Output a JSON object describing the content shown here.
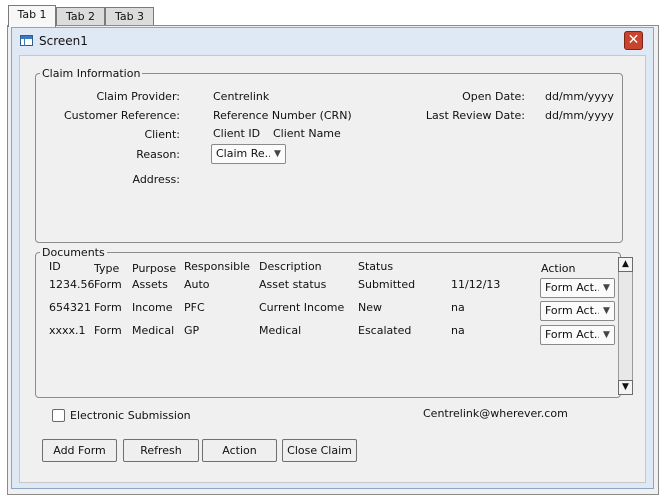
{
  "tabs": [
    {
      "label": "Tab 1"
    },
    {
      "label": "Tab 2"
    },
    {
      "label": "Tab 3"
    }
  ],
  "window": {
    "title": "Screen1",
    "close_label": "✕"
  },
  "claim_info": {
    "legend": "Claim Information",
    "provider_label": "Claim Provider:",
    "provider_value": "Centrelink",
    "reference_label": "Customer Reference:",
    "reference_value": "Reference Number (CRN)",
    "client_label": "Client:",
    "client_id": "Client ID",
    "client_name": "Client Name",
    "reason_label": "Reason:",
    "reason_value": "Claim Re...",
    "address_label": "Address:",
    "open_date_label": "Open Date:",
    "open_date_value": "dd/mm/yyyy",
    "last_review_label": "Last Review Date:",
    "last_review_value": "dd/mm/yyyy"
  },
  "documents": {
    "legend": "Documents",
    "headers": [
      "ID",
      "Type",
      "Purpose",
      "Responsible",
      "Description",
      "Status",
      "Action"
    ],
    "rows": [
      {
        "id": "1234.56",
        "type": "Form",
        "purpose": "Assets",
        "responsible": "Auto",
        "description": "Asset status",
        "status": "Submitted",
        "date": "11/12/13",
        "action": "Form Act..."
      },
      {
        "id": "654321",
        "type": "Form",
        "purpose": "Income",
        "responsible": "PFC",
        "description": "Current Income",
        "status": "New",
        "date": "na",
        "action": "Form Act..."
      },
      {
        "id": "xxxx.1",
        "type": "Form",
        "purpose": "Medical",
        "responsible": "GP",
        "description": "Medical",
        "status": "Escalated",
        "date": "na",
        "action": "Form Act..."
      }
    ]
  },
  "footer": {
    "electronic_label": "Electronic Submission",
    "email": "Centrelink@wherever.com"
  },
  "buttons": {
    "add_form": "Add Form",
    "refresh": "Refresh",
    "action": "Action",
    "close_claim": "Close Claim"
  }
}
